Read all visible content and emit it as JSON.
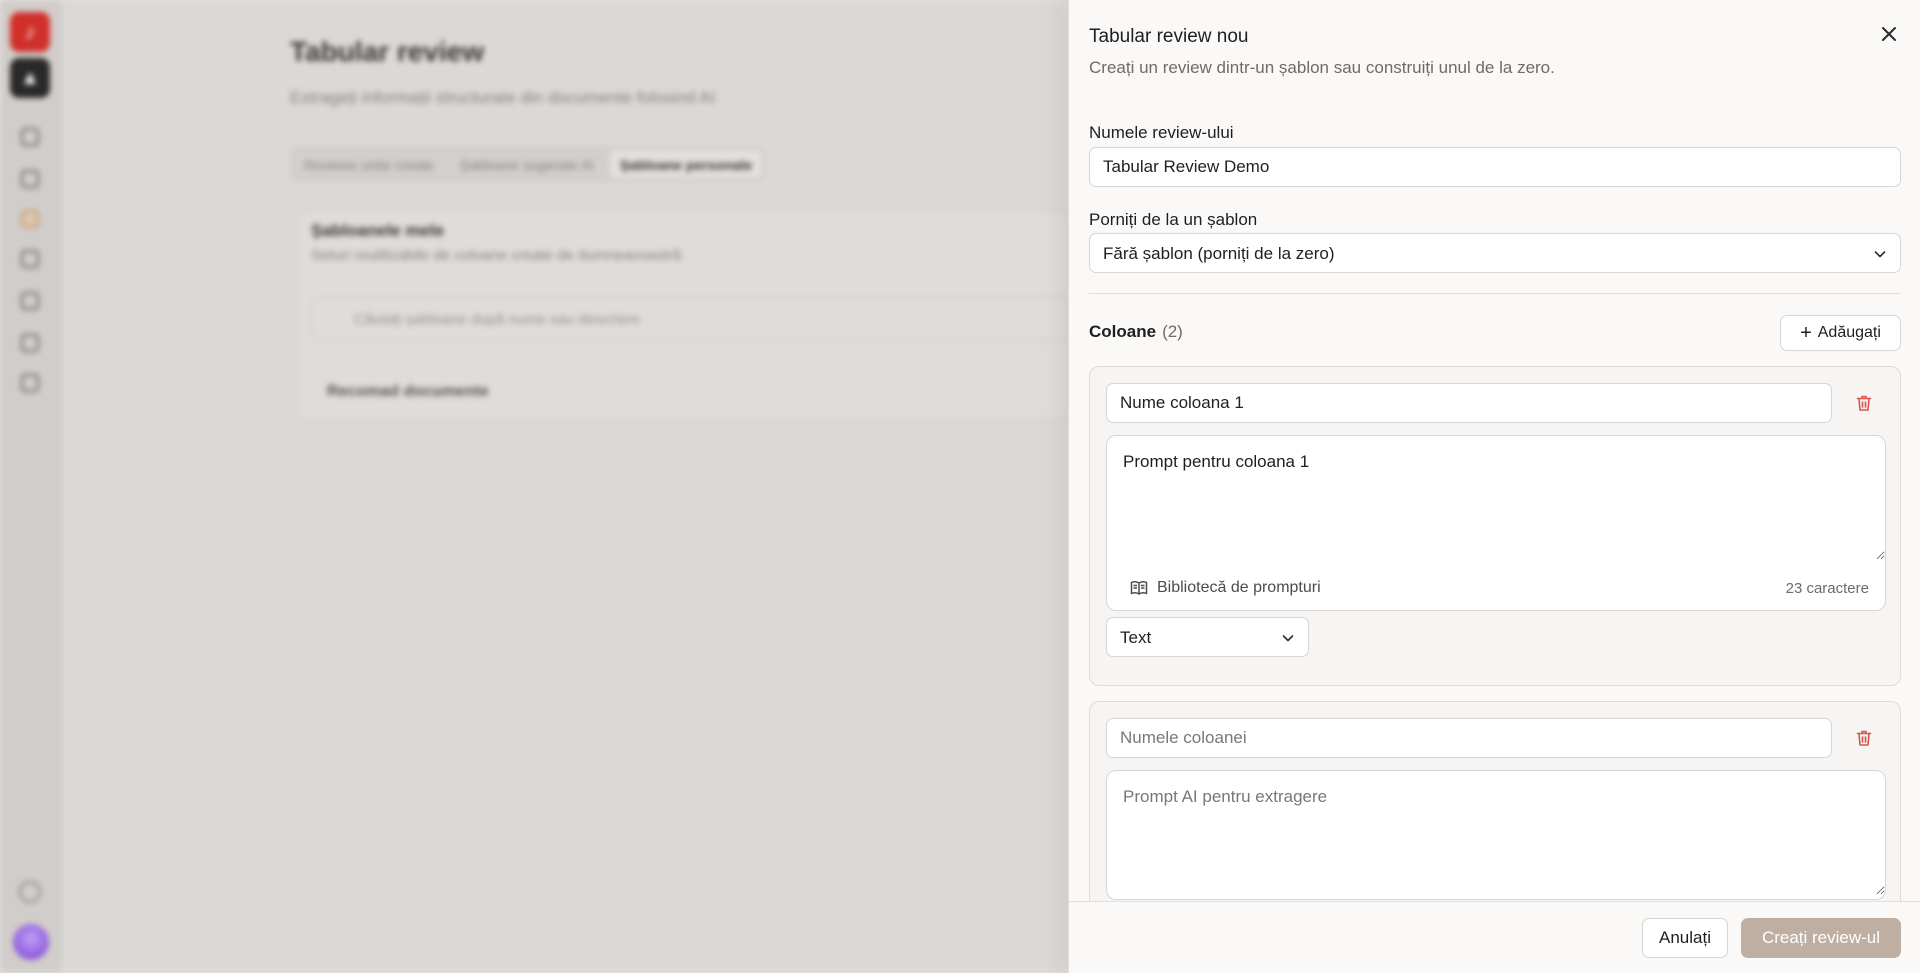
{
  "background": {
    "app_logo_glyph": "♪",
    "workspace_logo_glyph": "▲",
    "title": "Tabular review",
    "subtitle": "Extrageți informații structurate din documente folosind AI",
    "tabs": [
      {
        "label": "Reviews unite create"
      },
      {
        "label": "Șabloane sugerate AI"
      },
      {
        "label": "Șabloane personale"
      }
    ],
    "card": {
      "title": "Șabloanele mele",
      "subtitle": "Seturi reutilizabile de coloane create de dumneavoastră",
      "search_placeholder": "Căutați șabloane după nume sau descriere",
      "recommended": "Recomad documente"
    }
  },
  "drawer": {
    "title": "Tabular review nou",
    "description": "Creați un review dintr-un șablon sau construiți unul de la zero.",
    "review_name": {
      "label": "Numele review-ului",
      "value": "Tabular Review Demo"
    },
    "template": {
      "label": "Porniți de la un șablon",
      "selected": "Fără șablon (porniți de la zero)"
    },
    "columns": {
      "heading": "Coloane",
      "count": "(2)",
      "add_label": "Adăugați",
      "items": [
        {
          "name_value": "Nume coloana 1",
          "name_placeholder": "Numele coloanei",
          "prompt_value": "Prompt pentru coloana 1",
          "prompt_placeholder": "Prompt AI pentru extragere",
          "library_label": "Bibliotecă de prompturi",
          "char_count": "23 caractere",
          "type": "Text"
        },
        {
          "name_value": "",
          "name_placeholder": "Numele coloanei",
          "prompt_value": "",
          "prompt_placeholder": "Prompt AI pentru extragere"
        }
      ]
    },
    "footer": {
      "cancel_label": "Anulați",
      "create_label": "Creați review-ul"
    }
  },
  "colors": {
    "accent_disabled": "#bfaea2",
    "danger": "#d9534f",
    "drawer_bg": "#faf9f8"
  }
}
